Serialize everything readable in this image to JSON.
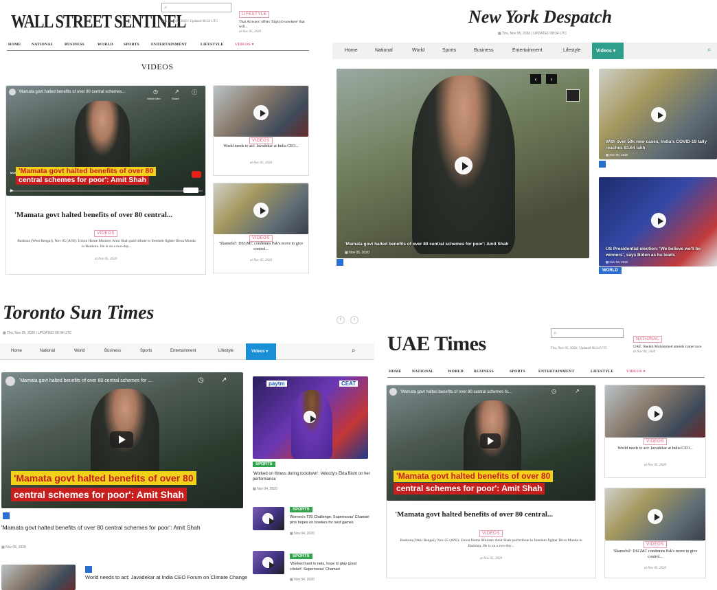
{
  "wss": {
    "logo": "WALL STREET SENTINEL",
    "search_placeholder": "",
    "date": "Thu, Nov 05, 2020 | Updated 08:34 UTC",
    "ticker_tag": "LIFESTYLE",
    "ticker_text": "Thai Airways' offers 'flight to nowhere' that will...",
    "ticker_date": "at Nov 05, 2020",
    "nav": [
      "HOME",
      "NATIONAL",
      "BUSINESS",
      "WORLD",
      "SPORTS",
      "ENTERTAINMENT",
      "LIFESTYLE",
      "VIDEOS"
    ],
    "section_title": "VIDEOS",
    "video_title": "'Mamata govt halted benefits of over 80 central schemes...",
    "caption_1": "'Mamata govt halted benefits of over 80",
    "caption_2": "central schemes for poor': Amit Shah",
    "watch_later": "Watch later",
    "share": "Share",
    "more_videos": "MORE VIDEOS",
    "main_headline": "'Mamata govt halted benefits of over 80 central...",
    "main_tag": "VIDEOS",
    "main_excerpt": "Bankura (West Bengal), Nov 05 (ANI): Union Home Minister Amit Shah paid tribute to freedom fighter Birsa Munda in Bankura. He is on a two-day...",
    "main_date": "at Nov 05, 2020",
    "side": [
      {
        "tag": "VIDEOS",
        "title": "World needs to act: Javadekar at India CEO...",
        "date": "at Nov 05, 2020"
      },
      {
        "tag": "VIDEOS",
        "title": "'Shameful': DSGMC condemns Pak's move to give control...",
        "date": "at Nov 05, 2020"
      }
    ]
  },
  "nyd": {
    "logo": "New York Despatch",
    "date": "Thu, Nov 05, 2020 | UPDATED 08:34 UTC",
    "nav": [
      "Home",
      "National",
      "World",
      "Sports",
      "Business",
      "Entertainment",
      "Lifestyle",
      "Videos"
    ],
    "main_caption": "'Mamata govt halted benefits of over 80 central schemes for poor': Amit Shah",
    "main_date": "Nov 05, 2020",
    "side": [
      {
        "title": "With over 50k new cases, India's COVID-19 tally reaches 83.64 lakh",
        "date": "Nov 05, 2020"
      },
      {
        "title": "US Presidential election: 'We believe we'll be winners', says Biden as he leads",
        "date": "Nov 04, 2020",
        "tag": "WORLD"
      }
    ]
  },
  "tst": {
    "logo": "Toronto Sun Times",
    "date": "Thu, Nov 05, 2020 | UPDATED 08:34 UTC",
    "nav": [
      "Home",
      "National",
      "World",
      "Business",
      "Sports",
      "Entertainment",
      "Lifestyle",
      "Videos"
    ],
    "video_title": "'Mamata govt halted benefits of over 80 central schemes for ...",
    "caption_1": "'Mamata govt halted benefits of over 80",
    "caption_2": "central schemes for poor': Amit Shah",
    "main_headline": "'Mamata govt halted benefits of over 80 central schemes for poor': Amit Shah",
    "main_date": "Nov 05, 2020",
    "second_title": "World needs to act: Javadekar at India CEO Forum on Climate Change",
    "side_top_tag": "SPORTS",
    "side_top_title": "'Worked on fitness during lockdown': Velocity's Ekta Bisht on her performance",
    "side_top_date": "Nov 04, 2020",
    "side_list": [
      {
        "tag": "SPORTS",
        "title": "Women's T20 Challenge: Supernovas' Chamari pins hopes on bowlers for next games",
        "date": "Nov 04, 2020"
      },
      {
        "tag": "SPORTS",
        "title": "'Worked hard in nets, hope to play good cricket': Supernovas' Chamari",
        "date": "Nov 04, 2020"
      }
    ],
    "banner_words": [
      "paytm",
      "CEAT"
    ]
  },
  "uae": {
    "logo": "UAE Times",
    "date": "Thu, Nov 05, 2020 | Updated 08:34 UTC",
    "ticker_tag": "NATIONAL",
    "ticker_text": "UAE: Sheikh Mohammed attends camel race",
    "ticker_date": "at Nov 04, 2020",
    "nav": [
      "HOME",
      "NATIONAL",
      "WORLD",
      "BUSINESS",
      "SPORTS",
      "ENTERTAINMENT",
      "LIFESTYLE",
      "VIDEOS"
    ],
    "video_title": "'Mamata govt halted benefits of over 80 central schemes fo...",
    "caption_1": "'Mamata govt halted benefits of over 80",
    "caption_2": "central schemes for poor': Amit Shah",
    "main_headline": "'Mamata govt halted benefits of over 80 central...",
    "main_tag": "VIDEOS",
    "main_excerpt": "Bankura (West Bengal), Nov 05 (ANI): Union Home Minister Amit Shah paid tribute to freedom fighter Birsa Munda in Bankura. He is on a two-day...",
    "main_date": "at Nov 05, 2020",
    "side": [
      {
        "tag": "VIDEOS",
        "title": "World needs to act: Javadekar at India CEO...",
        "date": "at Nov 05, 2020"
      },
      {
        "tag": "VIDEOS",
        "title": "'Shameful': DSGMC condemns Pak's move to give control...",
        "date": "at Nov 05, 2020"
      }
    ]
  },
  "colors": {
    "accent_pink": "#e2557a",
    "teal": "#2f9e8a",
    "blue": "#2a6fcf",
    "green": "#31a34b"
  }
}
